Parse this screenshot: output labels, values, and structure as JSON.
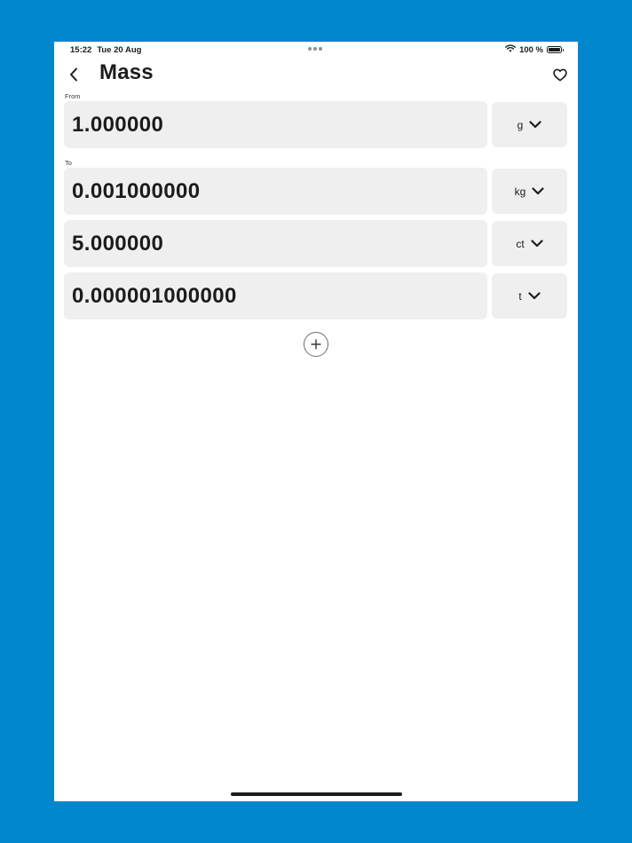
{
  "status_bar": {
    "time": "15:22",
    "date": "Tue 20 Aug",
    "battery": "100 %"
  },
  "nav": {
    "title": "Mass"
  },
  "from_section": {
    "label": "From",
    "value": "1.000000",
    "unit": "g"
  },
  "to_section": {
    "label": "To",
    "rows": [
      {
        "value": "0.001000000",
        "unit": "kg"
      },
      {
        "value": "5.000000",
        "unit": "ct"
      },
      {
        "value": "0.000001000000",
        "unit": "t"
      }
    ]
  },
  "icons": {
    "back": "chevron-left-icon",
    "favorite": "heart-outline-icon",
    "dropdown": "chevron-down-icon",
    "add": "plus-circle-icon",
    "wifi": "wifi-icon",
    "battery": "battery-full-icon"
  },
  "colors": {
    "background": "#0087cd",
    "field": "#f0eff0",
    "text": "#1c1c1e"
  }
}
